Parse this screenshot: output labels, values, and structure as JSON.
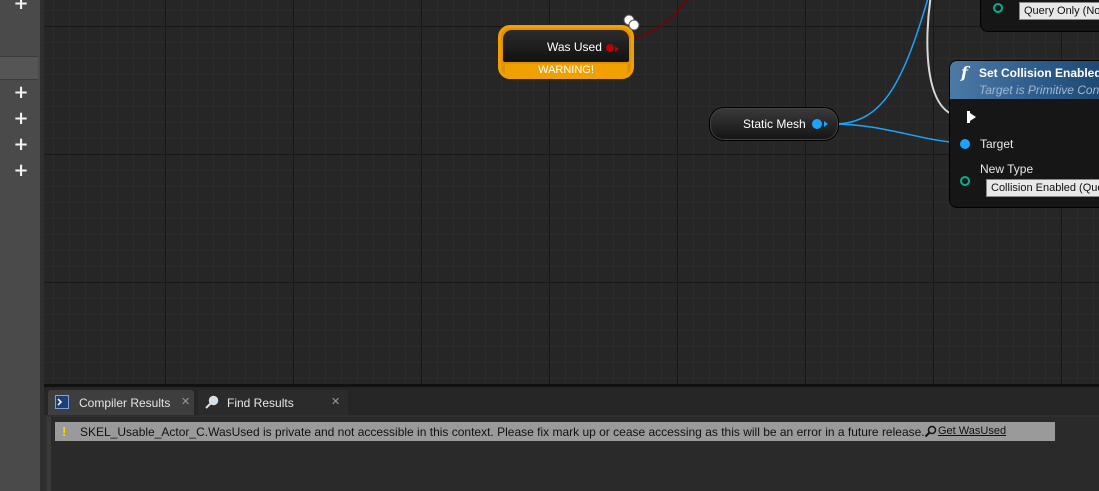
{
  "graph": {
    "was_used_node": {
      "label": "Was Used",
      "warning": "WARNING!"
    },
    "static_mesh_node": {
      "label": "Static Mesh"
    },
    "set_collision_node": {
      "title": "Set Collision Enabled",
      "subtitle": "Target is Primitive Con",
      "target_label": "Target",
      "new_type_label": "New Type",
      "new_type_value": "Collision Enabled (Que"
    },
    "top_node": {
      "combo_value": "Query Only (No"
    }
  },
  "results_panel": {
    "tabs": [
      {
        "label": "Compiler Results",
        "icon": "compiler-icon"
      },
      {
        "label": "Find Results",
        "icon": "search-icon"
      }
    ],
    "messages": [
      {
        "severity": "warning",
        "text": "SKEL_Usable_Actor_C.WasUsed is private and not accessible in this context. Please fix mark up or cease accessing as this will be an error in a future release.",
        "link": "Get WasUsed"
      }
    ]
  },
  "colors": {
    "object_pin": "#19a5ff",
    "bool_pin": "#c00000",
    "warning": "#f0a000",
    "function_header": "#4c79a6",
    "enum_pin": "#00b38c"
  }
}
